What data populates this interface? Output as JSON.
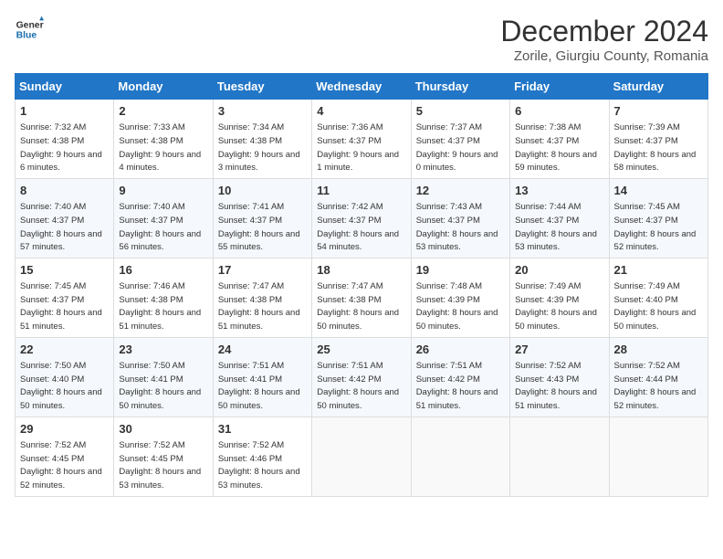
{
  "header": {
    "logo_line1": "General",
    "logo_line2": "Blue",
    "title": "December 2024",
    "subtitle": "Zorile, Giurgiu County, Romania"
  },
  "weekdays": [
    "Sunday",
    "Monday",
    "Tuesday",
    "Wednesday",
    "Thursday",
    "Friday",
    "Saturday"
  ],
  "weeks": [
    [
      {
        "day": 1,
        "sunrise": "7:32 AM",
        "sunset": "4:38 PM",
        "daylight": "9 hours and 6 minutes."
      },
      {
        "day": 2,
        "sunrise": "7:33 AM",
        "sunset": "4:38 PM",
        "daylight": "9 hours and 4 minutes."
      },
      {
        "day": 3,
        "sunrise": "7:34 AM",
        "sunset": "4:38 PM",
        "daylight": "9 hours and 3 minutes."
      },
      {
        "day": 4,
        "sunrise": "7:36 AM",
        "sunset": "4:37 PM",
        "daylight": "9 hours and 1 minute."
      },
      {
        "day": 5,
        "sunrise": "7:37 AM",
        "sunset": "4:37 PM",
        "daylight": "9 hours and 0 minutes."
      },
      {
        "day": 6,
        "sunrise": "7:38 AM",
        "sunset": "4:37 PM",
        "daylight": "8 hours and 59 minutes."
      },
      {
        "day": 7,
        "sunrise": "7:39 AM",
        "sunset": "4:37 PM",
        "daylight": "8 hours and 58 minutes."
      }
    ],
    [
      {
        "day": 8,
        "sunrise": "7:40 AM",
        "sunset": "4:37 PM",
        "daylight": "8 hours and 57 minutes."
      },
      {
        "day": 9,
        "sunrise": "7:40 AM",
        "sunset": "4:37 PM",
        "daylight": "8 hours and 56 minutes."
      },
      {
        "day": 10,
        "sunrise": "7:41 AM",
        "sunset": "4:37 PM",
        "daylight": "8 hours and 55 minutes."
      },
      {
        "day": 11,
        "sunrise": "7:42 AM",
        "sunset": "4:37 PM",
        "daylight": "8 hours and 54 minutes."
      },
      {
        "day": 12,
        "sunrise": "7:43 AM",
        "sunset": "4:37 PM",
        "daylight": "8 hours and 53 minutes."
      },
      {
        "day": 13,
        "sunrise": "7:44 AM",
        "sunset": "4:37 PM",
        "daylight": "8 hours and 53 minutes."
      },
      {
        "day": 14,
        "sunrise": "7:45 AM",
        "sunset": "4:37 PM",
        "daylight": "8 hours and 52 minutes."
      }
    ],
    [
      {
        "day": 15,
        "sunrise": "7:45 AM",
        "sunset": "4:37 PM",
        "daylight": "8 hours and 51 minutes."
      },
      {
        "day": 16,
        "sunrise": "7:46 AM",
        "sunset": "4:38 PM",
        "daylight": "8 hours and 51 minutes."
      },
      {
        "day": 17,
        "sunrise": "7:47 AM",
        "sunset": "4:38 PM",
        "daylight": "8 hours and 51 minutes."
      },
      {
        "day": 18,
        "sunrise": "7:47 AM",
        "sunset": "4:38 PM",
        "daylight": "8 hours and 50 minutes."
      },
      {
        "day": 19,
        "sunrise": "7:48 AM",
        "sunset": "4:39 PM",
        "daylight": "8 hours and 50 minutes."
      },
      {
        "day": 20,
        "sunrise": "7:49 AM",
        "sunset": "4:39 PM",
        "daylight": "8 hours and 50 minutes."
      },
      {
        "day": 21,
        "sunrise": "7:49 AM",
        "sunset": "4:40 PM",
        "daylight": "8 hours and 50 minutes."
      }
    ],
    [
      {
        "day": 22,
        "sunrise": "7:50 AM",
        "sunset": "4:40 PM",
        "daylight": "8 hours and 50 minutes."
      },
      {
        "day": 23,
        "sunrise": "7:50 AM",
        "sunset": "4:41 PM",
        "daylight": "8 hours and 50 minutes."
      },
      {
        "day": 24,
        "sunrise": "7:51 AM",
        "sunset": "4:41 PM",
        "daylight": "8 hours and 50 minutes."
      },
      {
        "day": 25,
        "sunrise": "7:51 AM",
        "sunset": "4:42 PM",
        "daylight": "8 hours and 50 minutes."
      },
      {
        "day": 26,
        "sunrise": "7:51 AM",
        "sunset": "4:42 PM",
        "daylight": "8 hours and 51 minutes."
      },
      {
        "day": 27,
        "sunrise": "7:52 AM",
        "sunset": "4:43 PM",
        "daylight": "8 hours and 51 minutes."
      },
      {
        "day": 28,
        "sunrise": "7:52 AM",
        "sunset": "4:44 PM",
        "daylight": "8 hours and 52 minutes."
      }
    ],
    [
      {
        "day": 29,
        "sunrise": "7:52 AM",
        "sunset": "4:45 PM",
        "daylight": "8 hours and 52 minutes."
      },
      {
        "day": 30,
        "sunrise": "7:52 AM",
        "sunset": "4:45 PM",
        "daylight": "8 hours and 53 minutes."
      },
      {
        "day": 31,
        "sunrise": "7:52 AM",
        "sunset": "4:46 PM",
        "daylight": "8 hours and 53 minutes."
      },
      null,
      null,
      null,
      null
    ]
  ]
}
